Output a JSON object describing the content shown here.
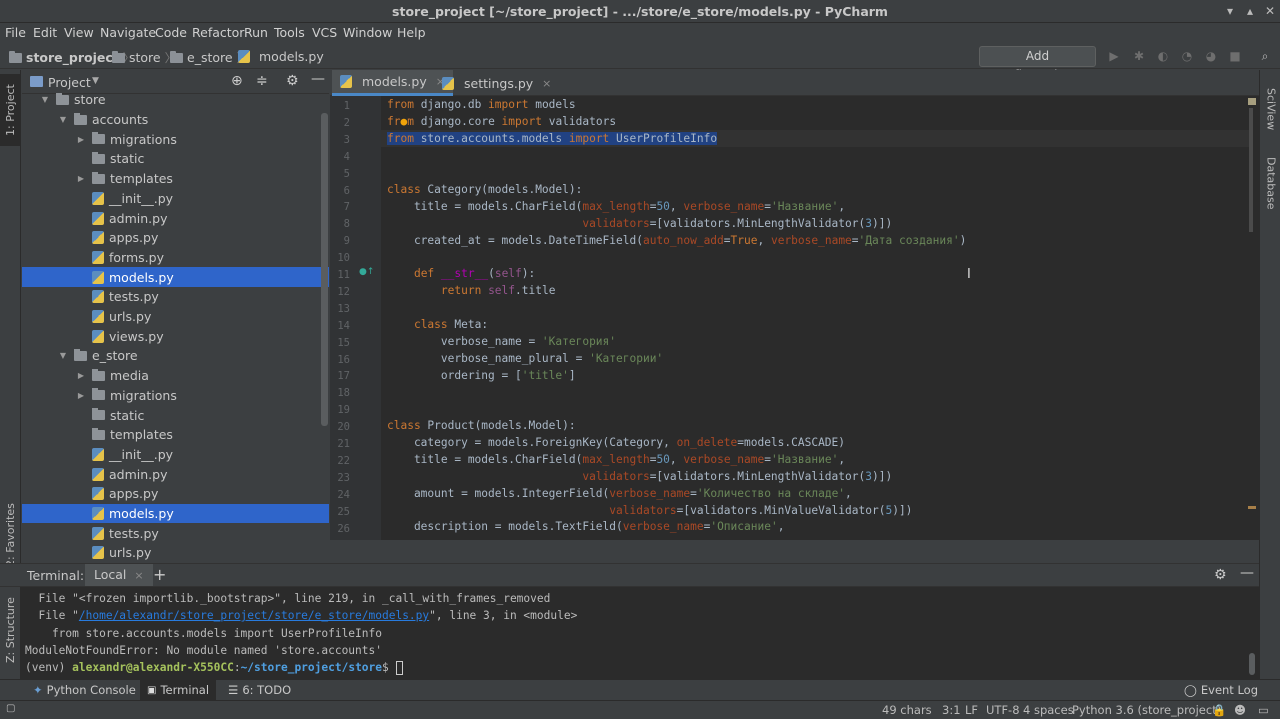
{
  "window": {
    "title": "store_project [~/store_project] - .../store/e_store/models.py - PyCharm"
  },
  "menu": [
    "File",
    "Edit",
    "View",
    "Navigate",
    "Code",
    "Refactor",
    "Run",
    "Tools",
    "VCS",
    "Window",
    "Help"
  ],
  "breadcrumbs": [
    "store_project",
    "store",
    "e_store",
    "models.py"
  ],
  "toolbar": {
    "add_config": "Add Configuration..."
  },
  "left_strip": {
    "project": "1: Project",
    "favorites": "2: Favorites",
    "structure": "Z: Structure"
  },
  "right_strip": {
    "sciview": "SciView",
    "database": "Database"
  },
  "project_panel": {
    "title": "Project",
    "tree": [
      {
        "label": "store",
        "type": "folder",
        "expanded": true
      },
      {
        "label": "accounts",
        "type": "folder",
        "expanded": true
      },
      {
        "label": "migrations",
        "type": "folder",
        "expanded": false
      },
      {
        "label": "static",
        "type": "folder"
      },
      {
        "label": "templates",
        "type": "folder",
        "expanded": false
      },
      {
        "label": "__init__.py",
        "type": "py"
      },
      {
        "label": "admin.py",
        "type": "py"
      },
      {
        "label": "apps.py",
        "type": "py"
      },
      {
        "label": "forms.py",
        "type": "py"
      },
      {
        "label": "models.py",
        "type": "py",
        "selected": true
      },
      {
        "label": "tests.py",
        "type": "py"
      },
      {
        "label": "urls.py",
        "type": "py"
      },
      {
        "label": "views.py",
        "type": "py"
      },
      {
        "label": "e_store",
        "type": "folder",
        "expanded": true
      },
      {
        "label": "media",
        "type": "folder",
        "expanded": false
      },
      {
        "label": "migrations",
        "type": "folder",
        "expanded": false
      },
      {
        "label": "static",
        "type": "folder"
      },
      {
        "label": "templates",
        "type": "folder"
      },
      {
        "label": "__init__.py",
        "type": "py"
      },
      {
        "label": "admin.py",
        "type": "py"
      },
      {
        "label": "apps.py",
        "type": "py"
      },
      {
        "label": "models.py",
        "type": "py",
        "selected": true
      },
      {
        "label": "tests.py",
        "type": "py"
      },
      {
        "label": "urls.py",
        "type": "py"
      }
    ]
  },
  "editor": {
    "tabs": [
      {
        "label": "models.py",
        "active": true
      },
      {
        "label": "settings.py",
        "active": false
      }
    ],
    "line_numbers": [
      "1",
      "2",
      "3",
      "4",
      "5",
      "6",
      "7",
      "8",
      "9",
      "10",
      "11",
      "12",
      "13",
      "14",
      "15",
      "16",
      "17",
      "18",
      "19",
      "20",
      "21",
      "22",
      "23",
      "24",
      "25",
      "26"
    ]
  },
  "terminal": {
    "label": "Terminal:",
    "tab": "Local",
    "lines": {
      "l1": "  File \"<frozen importlib._bootstrap>\", line 219, in _call_with_frames_removed",
      "l2a": "  File \"",
      "l2link": "/home/alexandr/store_project/store/e_store/models.py",
      "l2b": "\", line 3, in <module>",
      "l3": "    from store.accounts.models import UserProfileInfo",
      "l4": "ModuleNotFoundError: No module named 'store.accounts'",
      "p_venv": "(venv) ",
      "p_user": "alexandr@alexandr-X550CC",
      "p_colon": ":",
      "p_path": "~/store_project/store",
      "p_dollar": "$ "
    }
  },
  "bottom_tabs": {
    "python_console": "Python Console",
    "terminal": "Terminal",
    "todo": "6: TODO",
    "event_log": "Event Log"
  },
  "status": {
    "chars": "49 chars",
    "pos": "3:1",
    "lf": "LF",
    "enc": "UTF-8",
    "indent": "4 spaces",
    "interp": "Python 3.6 (store_project)"
  }
}
